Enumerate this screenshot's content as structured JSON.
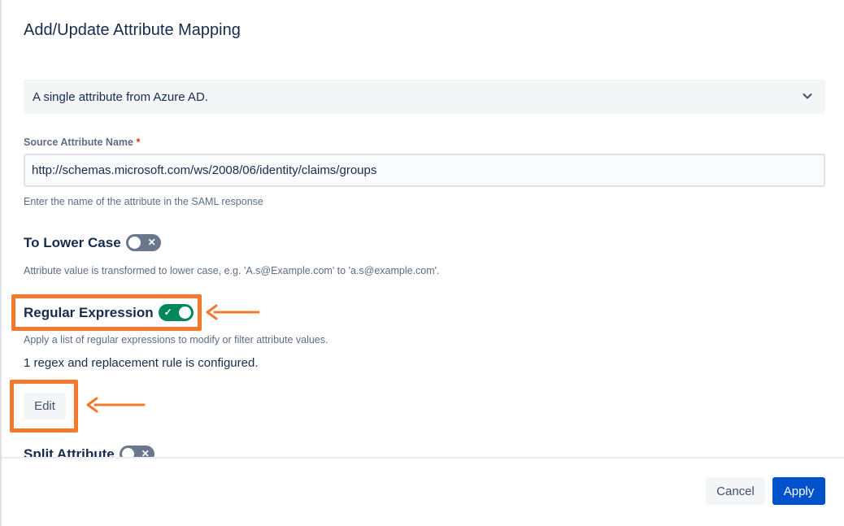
{
  "dialog": {
    "title": "Add/Update Attribute Mapping"
  },
  "source_select": {
    "value": "A single attribute from Azure AD.",
    "icon": "chevron-down-icon"
  },
  "source_attribute": {
    "label": "Source Attribute Name",
    "required_mark": "*",
    "value": "http://schemas.microsoft.com/ws/2008/06/identity/claims/groups",
    "help": "Enter the name of the attribute in the SAML response"
  },
  "to_lower_case": {
    "label": "To Lower Case",
    "enabled": false,
    "off_glyph": "✕",
    "help": "Attribute value is transformed to lower case, e.g. 'A.s@Example.com' to 'a.s@example.com'."
  },
  "regular_expression": {
    "label": "Regular Expression",
    "enabled": true,
    "on_glyph": "✓",
    "help": "Apply a list of regular expressions to modify or filter attribute values.",
    "status": "1 regex and replacement rule is configured.",
    "edit_label": "Edit"
  },
  "split_attribute": {
    "label": "Split Attribute",
    "enabled": false,
    "off_glyph": "✕"
  },
  "footer": {
    "cancel_label": "Cancel",
    "apply_label": "Apply"
  },
  "colors": {
    "highlight": "#f4792b",
    "toggle_on": "#00875a",
    "toggle_off": "#6b778c",
    "primary": "#0052cc"
  }
}
